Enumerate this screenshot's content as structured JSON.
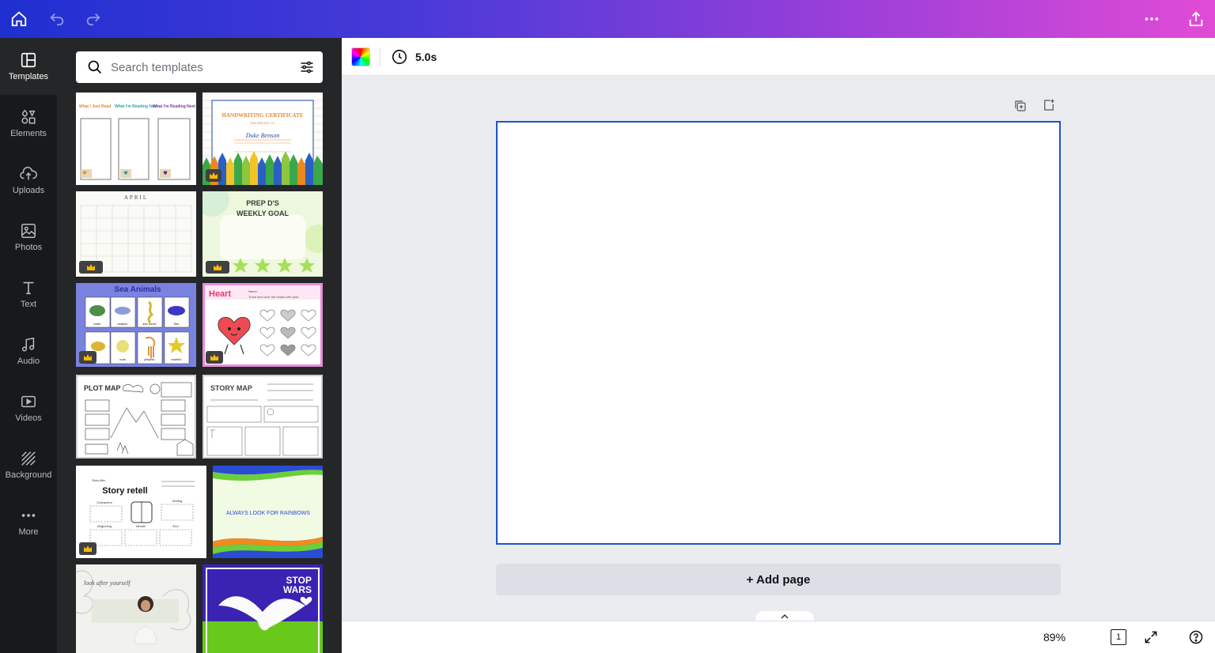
{
  "sidebar": {
    "items": [
      {
        "label": "Templates",
        "icon": "templates-icon",
        "active": true
      },
      {
        "label": "Elements",
        "icon": "elements-icon"
      },
      {
        "label": "Uploads",
        "icon": "uploads-icon"
      },
      {
        "label": "Photos",
        "icon": "photos-icon"
      },
      {
        "label": "Text",
        "icon": "text-icon"
      },
      {
        "label": "Audio",
        "icon": "audio-icon"
      },
      {
        "label": "Videos",
        "icon": "videos-icon"
      },
      {
        "label": "Background",
        "icon": "background-icon"
      },
      {
        "label": "More",
        "icon": "more-icon"
      }
    ]
  },
  "search": {
    "placeholder": "Search templates"
  },
  "templates": {
    "t1": {
      "col1": "What I Just Read",
      "col2": "What I'm Reading Now",
      "col3": "What I'm Reading Next"
    },
    "t2": {
      "title": "HANDWRITING CERTIFICATE",
      "presented": "PRESENTED TO",
      "name": "Duke Benson"
    },
    "t3": {
      "title": "APRIL"
    },
    "t4": {
      "title": "PREP D'S WEEKLY GOAL"
    },
    "t5": {
      "title": "Sea Animals",
      "labels": [
        "turtle",
        "dolphin",
        "sea horse",
        "fish",
        "crab",
        "jellyfish",
        "starfish"
      ]
    },
    "t6": {
      "title": "Heart",
      "name": "Name:",
      "sub": "Trace and color the hearts with pink."
    },
    "t7": {
      "title": "PLOT MAP"
    },
    "t8": {
      "title": "STORY MAP"
    },
    "t9": {
      "title": "Story retell",
      "story_title": "Story title:",
      "characters": "Characters",
      "setting": "Setting",
      "beginning": "Beginning",
      "middle": "Middle",
      "end": "End"
    },
    "t10": {
      "title": "ALWAYS LOOK FOR RAINBOWS"
    },
    "t11": {
      "title": "look after yourself"
    },
    "t12": {
      "title": "STOP WARS"
    }
  },
  "toolbar": {
    "duration": "5.0s"
  },
  "canvas": {
    "add_page_label": "+ Add page"
  },
  "bottom": {
    "zoom": "89%",
    "page_count": "1"
  },
  "colors": {
    "accent": "#1a56c4"
  }
}
